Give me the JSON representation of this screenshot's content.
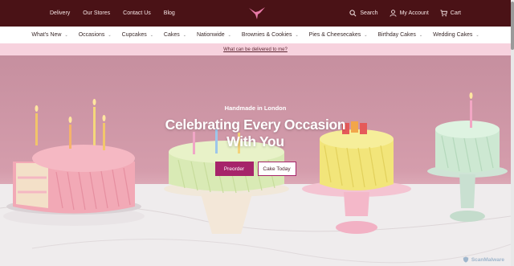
{
  "topbar": {
    "links": [
      "Delivery",
      "Our Stores",
      "Contact Us",
      "Blog"
    ],
    "search_label": "Search",
    "account_label": "My Account",
    "cart_label": "Cart",
    "background": "#4a1216"
  },
  "nav": {
    "items": [
      "What's New",
      "Occasions",
      "Cupcakes",
      "Cakes",
      "Nationwide",
      "Brownies & Cookies",
      "Pies & Cheesecakes",
      "Birthday Cakes",
      "Wedding Cakes"
    ]
  },
  "announcement": {
    "link_text": "What can be delivered to me?",
    "background": "#f7d2de"
  },
  "hero": {
    "eyebrow": "Handmade in London",
    "title_line1": "Celebrating Every Occasion",
    "title_line2": "With You",
    "primary_button": "Preorder",
    "secondary_button": "Cake Today",
    "accent": "#a6246a"
  },
  "watermark": {
    "text": "ScanMalware"
  }
}
